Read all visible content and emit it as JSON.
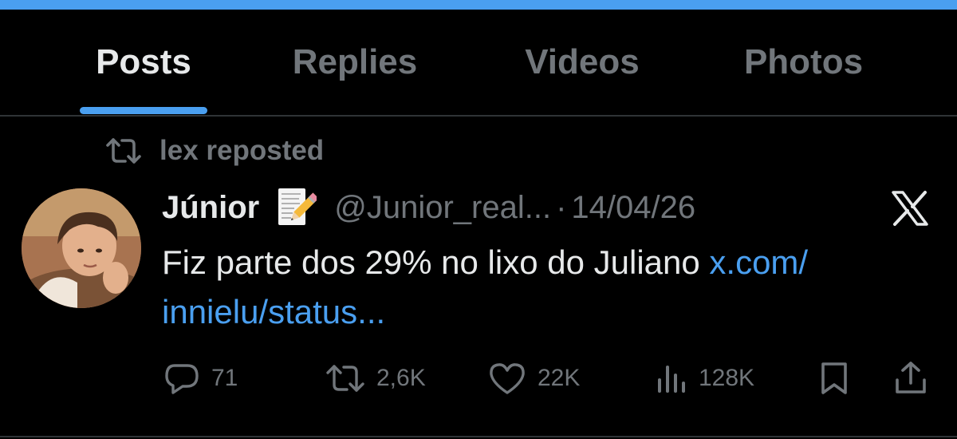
{
  "tabs": [
    {
      "label": "Posts",
      "active": true
    },
    {
      "label": "Replies",
      "active": false
    },
    {
      "label": "Videos",
      "active": false
    },
    {
      "label": "Photos",
      "active": false
    }
  ],
  "repost": {
    "text": "lex reposted",
    "icon": "repost-icon"
  },
  "tweet": {
    "display_name": "Júnior",
    "name_emoji": "memo-emoji",
    "handle": "@Junior_real...",
    "separator": "·",
    "date": "14/04/26",
    "text_before_link": "Fiz parte dos 29% no lixo do Juliano ",
    "link_text": "x.com/ innielu/status...",
    "actions": {
      "replies": "71",
      "reposts": "2,6K",
      "likes": "22K",
      "views": "128K"
    }
  },
  "colors": {
    "background": "#000000",
    "accent": "#4a9ff0",
    "primary_text": "#e7e9ea",
    "secondary_text": "#71767b",
    "divider": "#2f3336"
  }
}
